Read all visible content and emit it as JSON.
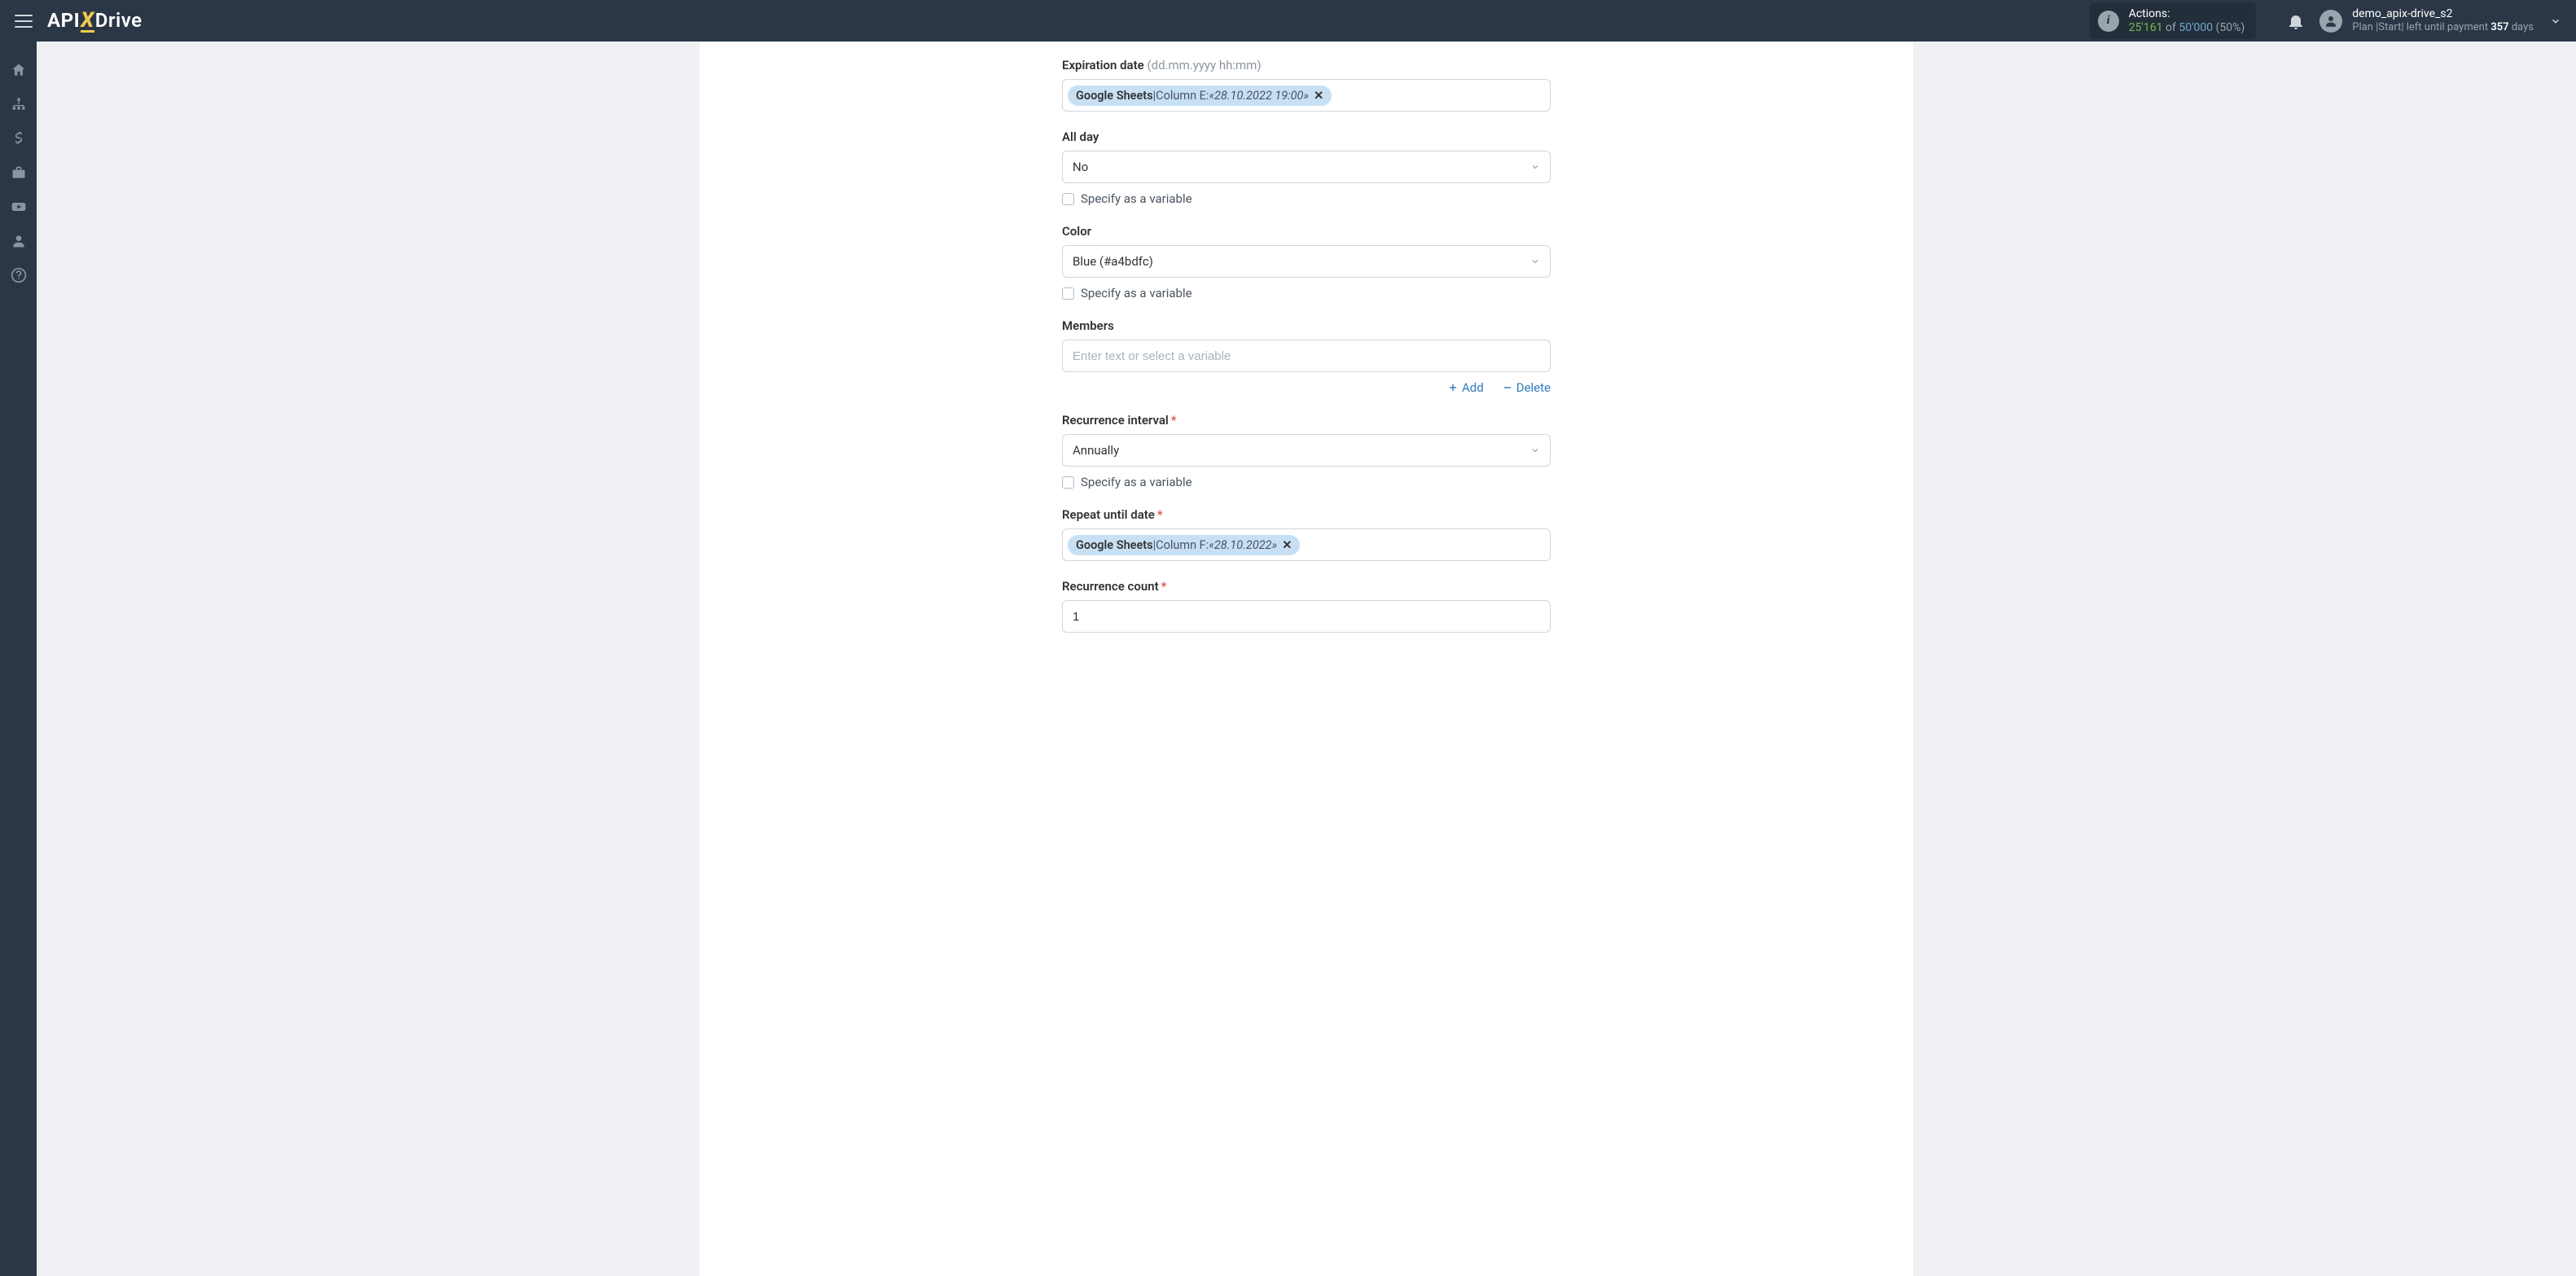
{
  "header": {
    "logo": {
      "api": "API",
      "x": "X",
      "drive": "Drive"
    },
    "actions": {
      "label": "Actions:",
      "used": "25'161",
      "of": "of",
      "total": "50'000",
      "pct": "(50%)"
    },
    "user": {
      "name": "demo_apix-drive_s2",
      "plan_prefix": "Plan |",
      "plan_name": "Start",
      "plan_mid": "| left until payment ",
      "days": "357",
      "days_suffix": " days"
    }
  },
  "form": {
    "expiration": {
      "label": "Expiration date",
      "hint": "(dd.mm.yyyy hh:mm)",
      "token_src": "Google Sheets",
      "token_sep": " | ",
      "token_col": "Column E: ",
      "token_val": "«28.10.2022 19:00»"
    },
    "allday": {
      "label": "All day",
      "value": "No"
    },
    "specify_var": "Specify as a variable",
    "color": {
      "label": "Color",
      "value": "Blue (#a4bdfc)"
    },
    "members": {
      "label": "Members",
      "placeholder": "Enter text or select a variable",
      "add": "Add",
      "delete": "Delete"
    },
    "recurrence_interval": {
      "label": "Recurrence interval",
      "value": "Annually"
    },
    "repeat_until": {
      "label": "Repeat until date",
      "token_src": "Google Sheets",
      "token_sep": " | ",
      "token_col": "Column F: ",
      "token_val": "«28.10.2022»"
    },
    "recurrence_count": {
      "label": "Recurrence count",
      "value": "1"
    }
  }
}
